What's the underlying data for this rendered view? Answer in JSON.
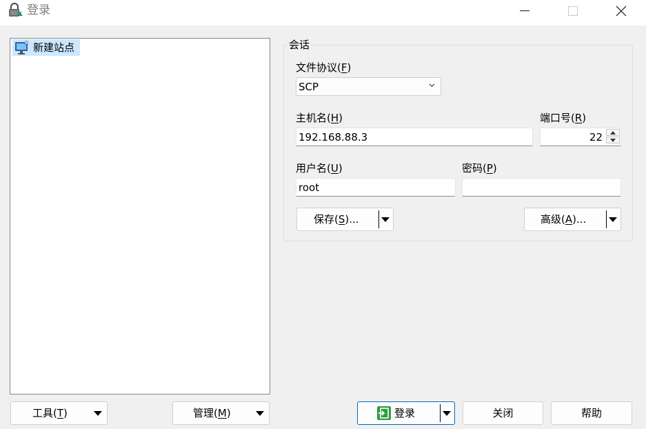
{
  "window": {
    "title": "登录",
    "controls": {
      "minimize": "minimize",
      "maximize": "maximize",
      "close": "close"
    }
  },
  "site_tree": {
    "items": [
      {
        "label": "新建站点",
        "icon": "monitor-new-site-icon",
        "selected": true
      }
    ]
  },
  "bottom_left": {
    "tools": {
      "text": "工具(",
      "mnemonic": "T",
      "suffix": ")"
    },
    "manage": {
      "text": "管理(",
      "mnemonic": "M",
      "suffix": ")"
    }
  },
  "session": {
    "group_title": "会话",
    "protocol": {
      "label_text": "文件协议(",
      "mnemonic": "F",
      "label_suffix": ")",
      "value": "SCP"
    },
    "host": {
      "label_text": "主机名(",
      "mnemonic": "H",
      "label_suffix": ")",
      "value": "192.168.88.3"
    },
    "port": {
      "label_text": "端口号(",
      "mnemonic": "R",
      "label_suffix": ")",
      "value": "22"
    },
    "user": {
      "label_text": "用户名(",
      "mnemonic": "U",
      "label_suffix": ")",
      "value": "root"
    },
    "password": {
      "label_text": "密码(",
      "mnemonic": "P",
      "label_suffix": ")",
      "value": ""
    },
    "save": {
      "text": "保存(",
      "mnemonic": "S",
      "suffix": ")..."
    },
    "advanced": {
      "text": "高级(",
      "mnemonic": "A",
      "suffix": ")..."
    }
  },
  "actions": {
    "login": "登录",
    "close": "关闭",
    "help": "帮助"
  },
  "colors": {
    "selection": "#cce8ff",
    "primary_border": "#0067c0",
    "login_icon_green": "#2e9e3e"
  }
}
